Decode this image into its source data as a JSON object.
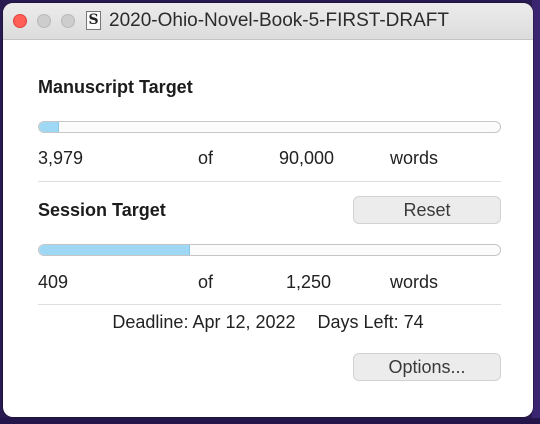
{
  "window": {
    "title": "2020-Ohio-Novel-Book-5-FIRST-DRAFT",
    "doc_icon_glyph": "S",
    "controls": [
      "close",
      "minimize",
      "zoom"
    ]
  },
  "manuscript": {
    "heading": "Manuscript Target",
    "current": "3,979",
    "of_label": "of",
    "target": "90,000",
    "unit": "words",
    "progress_fraction": 0.044
  },
  "session": {
    "heading": "Session Target",
    "reset_label": "Reset",
    "current": "409",
    "of_label": "of",
    "target": "1,250",
    "unit": "words",
    "progress_fraction": 0.327
  },
  "footer": {
    "deadline_text": "Deadline: Apr 12, 2022",
    "days_left_text": "Days Left: 74",
    "options_label": "Options..."
  },
  "colors": {
    "progress_fill": "#9fd8f5",
    "close_button": "#ff5f57"
  }
}
